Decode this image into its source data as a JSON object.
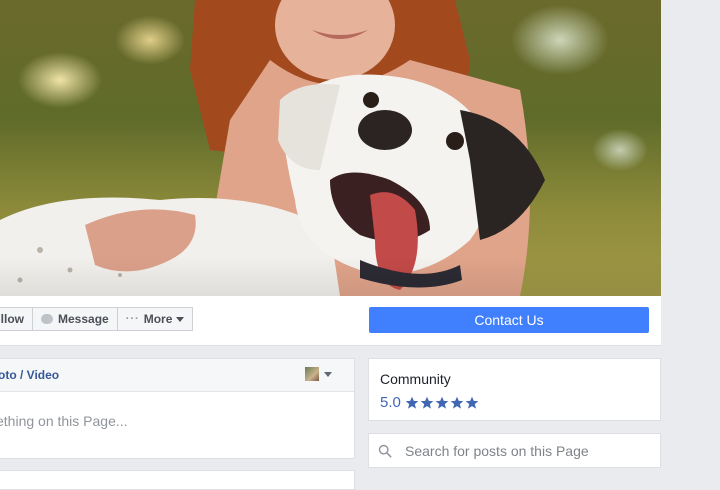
{
  "actions": {
    "follow_label": "llow",
    "message_label": "Message",
    "more_label": "More",
    "more_dots": "···",
    "contact_label": "Contact Us"
  },
  "composer": {
    "tab_label": "oto / Video",
    "placeholder": "ething on this Page..."
  },
  "community": {
    "title": "Community",
    "rating": "5.0",
    "stars": 5
  },
  "search": {
    "placeholder": "Search for posts on this Page"
  },
  "colors": {
    "primary_button": "#4080ff",
    "link": "#365899",
    "star": "#4267b2",
    "page_bg": "#e9ebee"
  }
}
